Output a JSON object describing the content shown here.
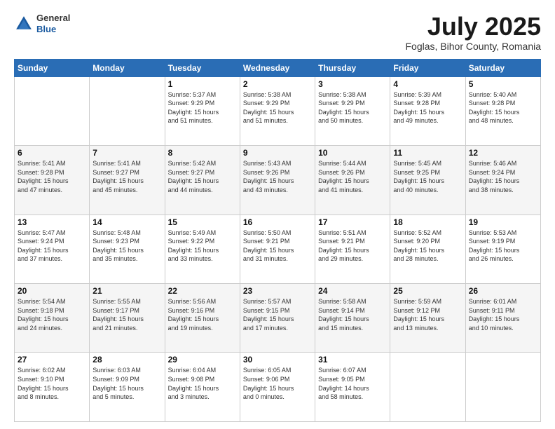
{
  "header": {
    "logo": {
      "general": "General",
      "blue": "Blue"
    },
    "title": "July 2025",
    "location": "Foglas, Bihor County, Romania"
  },
  "weekdays": [
    "Sunday",
    "Monday",
    "Tuesday",
    "Wednesday",
    "Thursday",
    "Friday",
    "Saturday"
  ],
  "weeks": [
    [
      {
        "day": "",
        "info": ""
      },
      {
        "day": "",
        "info": ""
      },
      {
        "day": "1",
        "info": "Sunrise: 5:37 AM\nSunset: 9:29 PM\nDaylight: 15 hours\nand 51 minutes."
      },
      {
        "day": "2",
        "info": "Sunrise: 5:38 AM\nSunset: 9:29 PM\nDaylight: 15 hours\nand 51 minutes."
      },
      {
        "day": "3",
        "info": "Sunrise: 5:38 AM\nSunset: 9:29 PM\nDaylight: 15 hours\nand 50 minutes."
      },
      {
        "day": "4",
        "info": "Sunrise: 5:39 AM\nSunset: 9:28 PM\nDaylight: 15 hours\nand 49 minutes."
      },
      {
        "day": "5",
        "info": "Sunrise: 5:40 AM\nSunset: 9:28 PM\nDaylight: 15 hours\nand 48 minutes."
      }
    ],
    [
      {
        "day": "6",
        "info": "Sunrise: 5:41 AM\nSunset: 9:28 PM\nDaylight: 15 hours\nand 47 minutes."
      },
      {
        "day": "7",
        "info": "Sunrise: 5:41 AM\nSunset: 9:27 PM\nDaylight: 15 hours\nand 45 minutes."
      },
      {
        "day": "8",
        "info": "Sunrise: 5:42 AM\nSunset: 9:27 PM\nDaylight: 15 hours\nand 44 minutes."
      },
      {
        "day": "9",
        "info": "Sunrise: 5:43 AM\nSunset: 9:26 PM\nDaylight: 15 hours\nand 43 minutes."
      },
      {
        "day": "10",
        "info": "Sunrise: 5:44 AM\nSunset: 9:26 PM\nDaylight: 15 hours\nand 41 minutes."
      },
      {
        "day": "11",
        "info": "Sunrise: 5:45 AM\nSunset: 9:25 PM\nDaylight: 15 hours\nand 40 minutes."
      },
      {
        "day": "12",
        "info": "Sunrise: 5:46 AM\nSunset: 9:24 PM\nDaylight: 15 hours\nand 38 minutes."
      }
    ],
    [
      {
        "day": "13",
        "info": "Sunrise: 5:47 AM\nSunset: 9:24 PM\nDaylight: 15 hours\nand 37 minutes."
      },
      {
        "day": "14",
        "info": "Sunrise: 5:48 AM\nSunset: 9:23 PM\nDaylight: 15 hours\nand 35 minutes."
      },
      {
        "day": "15",
        "info": "Sunrise: 5:49 AM\nSunset: 9:22 PM\nDaylight: 15 hours\nand 33 minutes."
      },
      {
        "day": "16",
        "info": "Sunrise: 5:50 AM\nSunset: 9:21 PM\nDaylight: 15 hours\nand 31 minutes."
      },
      {
        "day": "17",
        "info": "Sunrise: 5:51 AM\nSunset: 9:21 PM\nDaylight: 15 hours\nand 29 minutes."
      },
      {
        "day": "18",
        "info": "Sunrise: 5:52 AM\nSunset: 9:20 PM\nDaylight: 15 hours\nand 28 minutes."
      },
      {
        "day": "19",
        "info": "Sunrise: 5:53 AM\nSunset: 9:19 PM\nDaylight: 15 hours\nand 26 minutes."
      }
    ],
    [
      {
        "day": "20",
        "info": "Sunrise: 5:54 AM\nSunset: 9:18 PM\nDaylight: 15 hours\nand 24 minutes."
      },
      {
        "day": "21",
        "info": "Sunrise: 5:55 AM\nSunset: 9:17 PM\nDaylight: 15 hours\nand 21 minutes."
      },
      {
        "day": "22",
        "info": "Sunrise: 5:56 AM\nSunset: 9:16 PM\nDaylight: 15 hours\nand 19 minutes."
      },
      {
        "day": "23",
        "info": "Sunrise: 5:57 AM\nSunset: 9:15 PM\nDaylight: 15 hours\nand 17 minutes."
      },
      {
        "day": "24",
        "info": "Sunrise: 5:58 AM\nSunset: 9:14 PM\nDaylight: 15 hours\nand 15 minutes."
      },
      {
        "day": "25",
        "info": "Sunrise: 5:59 AM\nSunset: 9:12 PM\nDaylight: 15 hours\nand 13 minutes."
      },
      {
        "day": "26",
        "info": "Sunrise: 6:01 AM\nSunset: 9:11 PM\nDaylight: 15 hours\nand 10 minutes."
      }
    ],
    [
      {
        "day": "27",
        "info": "Sunrise: 6:02 AM\nSunset: 9:10 PM\nDaylight: 15 hours\nand 8 minutes."
      },
      {
        "day": "28",
        "info": "Sunrise: 6:03 AM\nSunset: 9:09 PM\nDaylight: 15 hours\nand 5 minutes."
      },
      {
        "day": "29",
        "info": "Sunrise: 6:04 AM\nSunset: 9:08 PM\nDaylight: 15 hours\nand 3 minutes."
      },
      {
        "day": "30",
        "info": "Sunrise: 6:05 AM\nSunset: 9:06 PM\nDaylight: 15 hours\nand 0 minutes."
      },
      {
        "day": "31",
        "info": "Sunrise: 6:07 AM\nSunset: 9:05 PM\nDaylight: 14 hours\nand 58 minutes."
      },
      {
        "day": "",
        "info": ""
      },
      {
        "day": "",
        "info": ""
      }
    ]
  ]
}
